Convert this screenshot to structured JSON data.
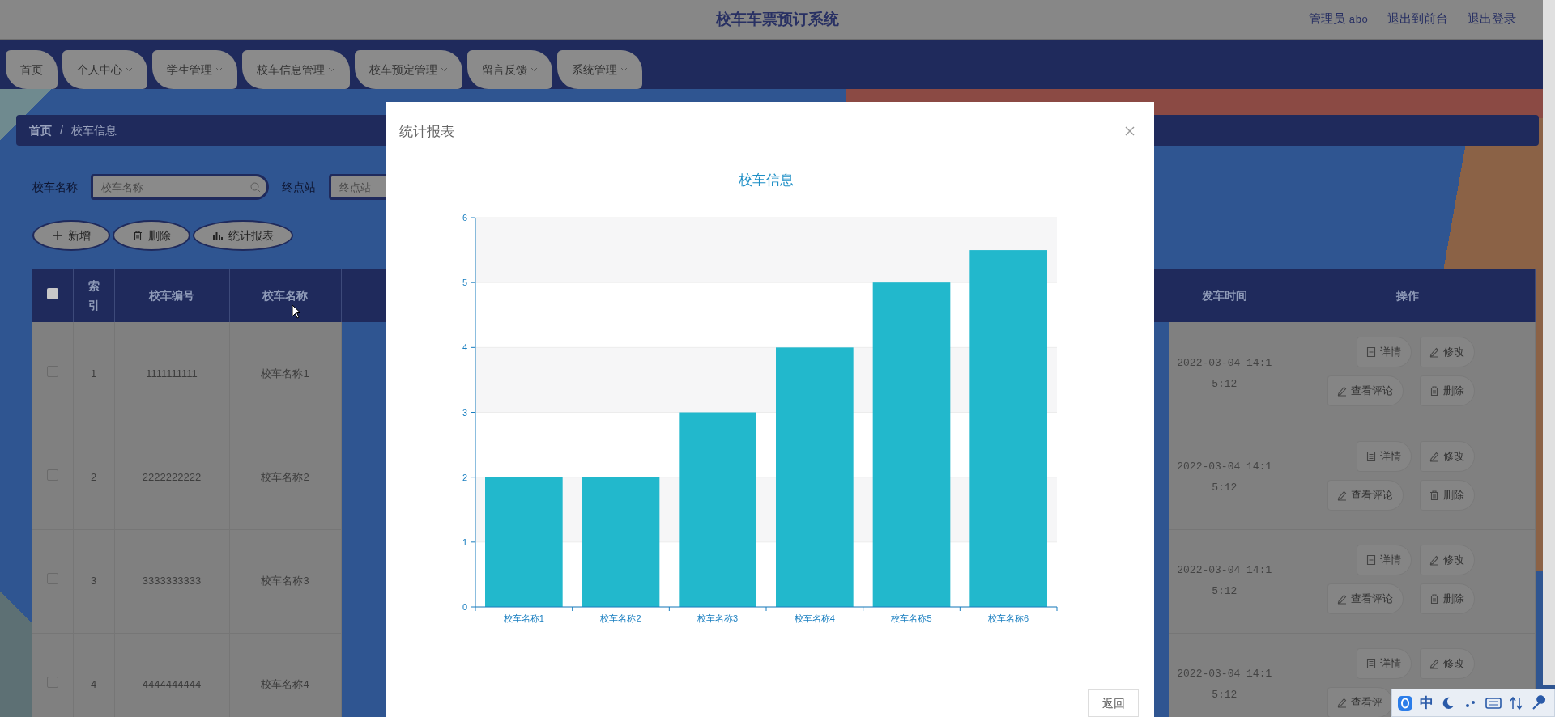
{
  "header": {
    "title": "校车车票预订系统",
    "user_role": "管理员",
    "user_name": "abo",
    "links": [
      "退出到前台",
      "退出登录"
    ]
  },
  "nav": [
    {
      "label": "首页",
      "has_menu": false
    },
    {
      "label": "个人中心",
      "has_menu": true
    },
    {
      "label": "学生管理",
      "has_menu": true
    },
    {
      "label": "校车信息管理",
      "has_menu": true
    },
    {
      "label": "校车预定管理",
      "has_menu": true
    },
    {
      "label": "留言反馈",
      "has_menu": true
    },
    {
      "label": "系统管理",
      "has_menu": true
    }
  ],
  "breadcrumb": {
    "items": [
      "首页",
      "校车信息"
    ],
    "separator": "/"
  },
  "search": [
    {
      "label": "校车名称",
      "placeholder": "校车名称",
      "kind": "search"
    },
    {
      "label": "终点站",
      "placeholder": "终点站",
      "kind": "plain"
    }
  ],
  "toolbar": [
    "新增",
    "删除",
    "统计报表"
  ],
  "table": {
    "all_selected": false,
    "columns": [
      "索引",
      "校车编号",
      "校车名称",
      "发车时间",
      "操作"
    ],
    "rows": [
      {
        "selected": false,
        "index": "1",
        "number": "1111111111",
        "name": "校车名称1",
        "departure": "2022-03-04 14:15:12",
        "actions": [
          "详情",
          "修改",
          "查看评论",
          "删除"
        ]
      },
      {
        "selected": false,
        "index": "2",
        "number": "2222222222",
        "name": "校车名称2",
        "departure": "2022-03-04 14:15:12",
        "actions": [
          "详情",
          "修改",
          "查看评论",
          "删除"
        ]
      },
      {
        "selected": false,
        "index": "3",
        "number": "3333333333",
        "name": "校车名称3",
        "departure": "2022-03-04 14:15:12",
        "actions": [
          "详情",
          "修改",
          "查看评论",
          "删除"
        ]
      },
      {
        "selected": false,
        "index": "4",
        "number": "4444444444",
        "name": "校车名称4",
        "departure": "2022-03-04 14:15:12",
        "actions": [
          "详情",
          "修改",
          "查看评"
        ]
      }
    ]
  },
  "modal": {
    "title": "统计报表",
    "buttons": [
      "返回"
    ],
    "chart_data": {
      "type": "bar",
      "title": "校车信息",
      "categories": [
        "校车名称1",
        "校车名称2",
        "校车名称3",
        "校车名称4",
        "校车名称5",
        "校车名称6"
      ],
      "series": [
        {
          "color": "#22b8cc",
          "values": [
            2,
            2,
            3,
            4,
            5,
            5.5
          ]
        }
      ],
      "ylim": [
        0,
        6
      ],
      "yticks": [
        0,
        1,
        2,
        3,
        4,
        5,
        6
      ],
      "grid": true
    }
  },
  "ime_toolbar": {
    "label": "中"
  }
}
